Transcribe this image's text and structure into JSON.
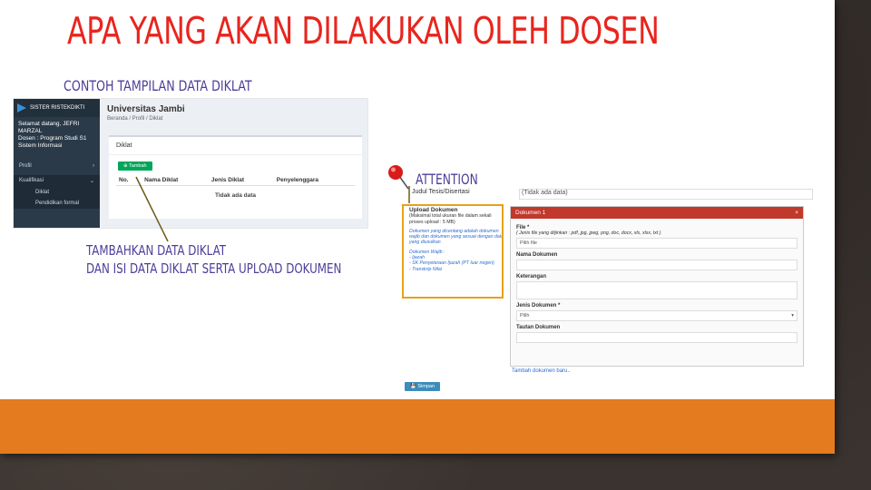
{
  "slide": {
    "title": "APA YANG AKAN DILAKUKAN OLEH DOSEN",
    "subtitle": "CONTOH TAMPILAN DATA DIKLAT",
    "caption_line1": "TAMBAHKAN DATA DIKLAT",
    "caption_line2": "DAN ISI DATA DIKLAT SERTA UPLOAD DOKUMEN",
    "attention": "ATTENTION",
    "band_color": "#e47b1e",
    "title_color": "#e8251e",
    "text_color": "#4b3f9a"
  },
  "screen1": {
    "app_name": "SISTER RISTEKDIKTI",
    "user_line1": "Selamat datang, JEFRI",
    "user_line2": "MARZAL",
    "user_line3": "Dosen : Program Studi S1",
    "user_line4": "Sistem Informasi",
    "menu_profil": "Profil",
    "menu_kualifikasi": "Kualifikasi",
    "menu_diklat": "Diklat",
    "menu_pendidikan": "Pendidikan formal",
    "institution": "Universitas Jambi",
    "breadcrumb": "Beranda  /  Profil  /  Diklat",
    "card_title": "Diklat",
    "add_button": "Tambah",
    "columns": [
      "No.",
      "Nama Diklat",
      "Jenis Diklat",
      "Penyelenggara"
    ],
    "empty_text": "Tidak ada data"
  },
  "screen2": {
    "thesis_label": "Judul Tesis/Disertasi",
    "thesis_value": "(Tidak ada data)",
    "upload_title": "Upload Dokumen",
    "upload_note": "(Maksimal total ukuran file dalam sekali proses upload : 5 MB)",
    "upload_warning": "Dokumen yang dicentang adalah dokumen wajib dan dokumen yang sesuai dengan data yang diusulkan",
    "required_title": "Dokumen Wajib :",
    "required_items": [
      "- Ijazah",
      "- SK Penyetaraan Ijazah (PT luar negeri)",
      "- Transkrip Nilai"
    ],
    "modal_title": "Dokumen 1",
    "modal_close": "×",
    "file_label": "File *",
    "file_hint": "( Jenis file yang diijinkan : pdf, jpg, jpeg, png, doc, docx, xls, xlsx, txt )",
    "file_button": "Pilih file",
    "name_label": "Nama Dokumen",
    "notes_label": "Keterangan",
    "type_label": "Jenis Dokumen *",
    "type_value": "Pilih",
    "link_label": "Tautan Dokumen",
    "add_more": "Tambah dokumen baru..",
    "save_button": "Simpan"
  }
}
